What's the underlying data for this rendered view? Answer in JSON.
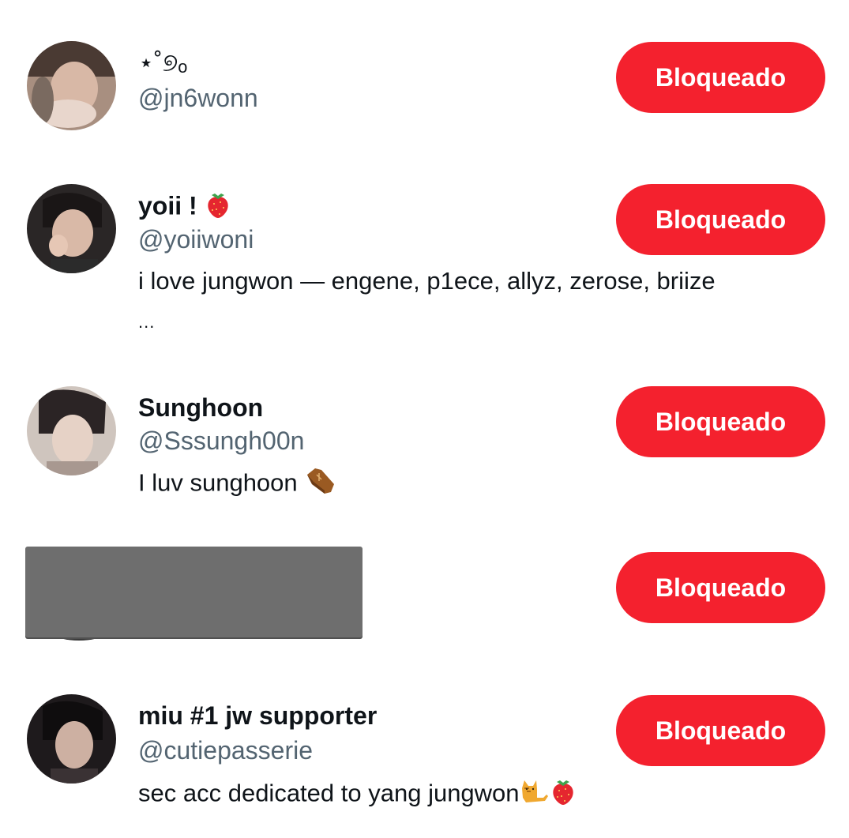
{
  "users": [
    {
      "display_name": "⋆˚୭ₒ",
      "handle": "@jn6wonn",
      "bio": "",
      "button_label": "Bloqueado"
    },
    {
      "display_name": "yoii !",
      "handle": "@yoiiwoni",
      "bio": "i love jungwon — engene, p1ece, allyz, zerose, briize",
      "bio_more": "...",
      "button_label": "Bloqueado"
    },
    {
      "display_name": "Sunghoon",
      "handle": "@Sssungh00n",
      "bio": "I luv sunghoon",
      "button_label": "Bloqueado"
    },
    {
      "display_name": "",
      "handle": "",
      "bio": "",
      "button_label": "Bloqueado"
    },
    {
      "display_name": "miu #1 jw supporter",
      "handle": "@cutiepasserie",
      "bio": "sec acc dedicated to yang jungwon",
      "button_label": "Bloqueado"
    }
  ],
  "colors": {
    "block_button": "#f4212e",
    "handle_text": "#536471",
    "primary_text": "#0f1419",
    "redaction": "#6e6e6e"
  },
  "icons": {
    "strawberry": "strawberry-emoji",
    "coffin": "coffin-emoji",
    "cat": "cat-emoji"
  }
}
